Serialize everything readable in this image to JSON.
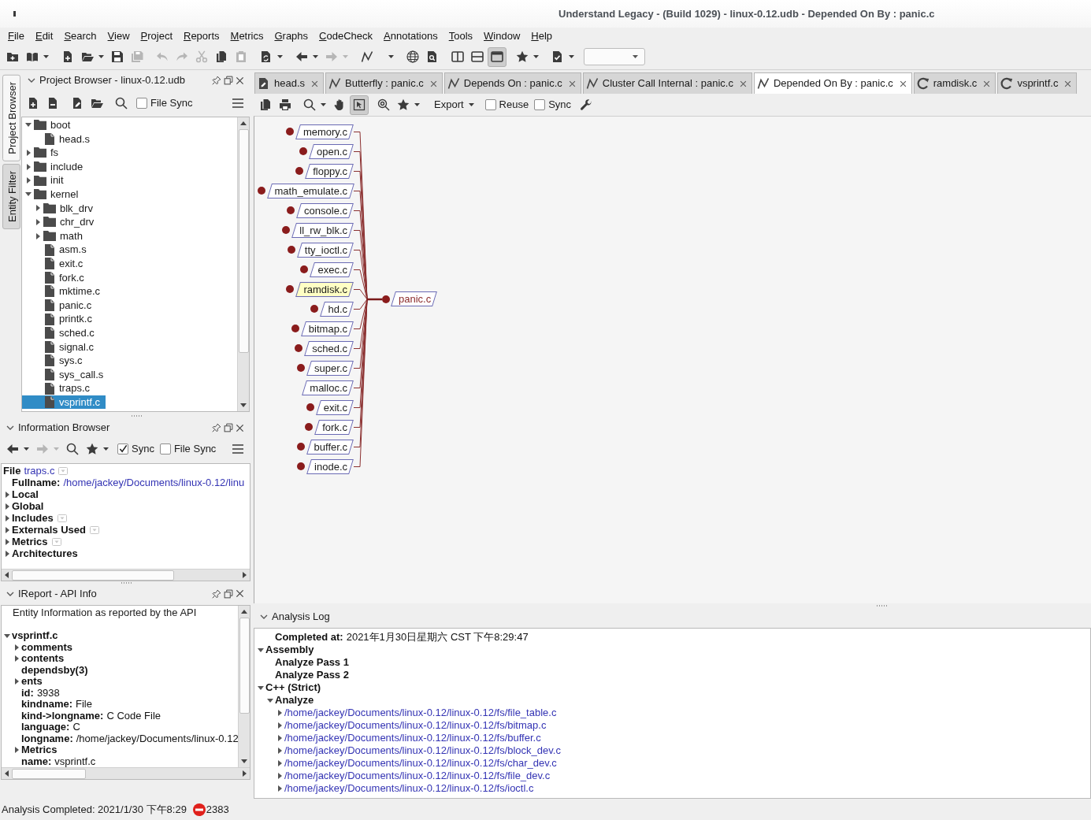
{
  "window": {
    "title": "Understand Legacy - (Build 1029) - linux-0.12.udb - Depended On By : panic.c"
  },
  "menu": [
    "File",
    "Edit",
    "Search",
    "View",
    "Project",
    "Reports",
    "Metrics",
    "Graphs",
    "CodeCheck",
    "Annotations",
    "Tools",
    "Window",
    "Help"
  ],
  "toolbar": [
    [
      {
        "kind": "addfolder",
        "dropdown": false,
        "disabled": false,
        "pressed": false
      },
      {
        "kind": "book",
        "dropdown": true,
        "disabled": false,
        "pressed": false
      }
    ],
    [
      {
        "kind": "addfile",
        "dropdown": false,
        "disabled": false,
        "pressed": false
      },
      {
        "kind": "folder",
        "dropdown": true,
        "disabled": false,
        "pressed": false
      },
      {
        "kind": "save",
        "dropdown": false,
        "disabled": false,
        "pressed": false
      },
      {
        "kind": "saveall",
        "dropdown": false,
        "disabled": true,
        "pressed": false
      }
    ],
    [
      {
        "kind": "undo",
        "dropdown": false,
        "disabled": true,
        "pressed": false
      },
      {
        "kind": "redo",
        "dropdown": false,
        "disabled": true,
        "pressed": false
      },
      {
        "kind": "cut",
        "dropdown": false,
        "disabled": true,
        "pressed": false
      },
      {
        "kind": "copy",
        "dropdown": false,
        "disabled": false,
        "pressed": false
      },
      {
        "kind": "paste",
        "dropdown": false,
        "disabled": true,
        "pressed": false
      }
    ],
    [
      {
        "kind": "sync",
        "dropdown": true,
        "disabled": false,
        "pressed": false
      }
    ],
    [
      {
        "kind": "back",
        "dropdown": true,
        "disabled": false,
        "pressed": false
      },
      {
        "kind": "forward",
        "dropdown": true,
        "disabled": true,
        "pressed": false
      }
    ],
    [
      {
        "kind": "graph",
        "dropdown": true,
        "disabled": false,
        "pressed": false
      }
    ],
    [
      {
        "kind": "globe",
        "dropdown": false,
        "disabled": false,
        "pressed": false
      },
      {
        "kind": "inspect",
        "dropdown": false,
        "disabled": false,
        "pressed": false
      }
    ],
    [
      {
        "kind": "columns",
        "dropdown": false,
        "disabled": false,
        "pressed": false
      },
      {
        "kind": "rows",
        "dropdown": false,
        "disabled": false,
        "pressed": false
      },
      {
        "kind": "window",
        "dropdown": false,
        "disabled": false,
        "pressed": true
      }
    ],
    [
      {
        "kind": "star",
        "dropdown": true,
        "disabled": false,
        "pressed": false
      }
    ],
    [
      {
        "kind": "checklist",
        "dropdown": true,
        "disabled": false,
        "pressed": false
      }
    ],
    [
      {
        "kind": "combo"
      }
    ]
  ],
  "side_tabs": [
    {
      "label": "Project Browser",
      "selected": true
    },
    {
      "label": "Entity Filter",
      "selected": false
    }
  ],
  "project_browser": {
    "title": "Project Browser - linux-0.12.udb",
    "toolbar": [
      [
        {
          "kind": "addfile",
          "dropdown": false,
          "disabled": false,
          "pressed": false
        },
        {
          "kind": "removefile",
          "dropdown": false,
          "disabled": false,
          "pressed": false
        }
      ],
      [
        {
          "kind": "editfile",
          "dropdown": false,
          "disabled": false,
          "pressed": false
        },
        {
          "kind": "folder",
          "dropdown": false,
          "disabled": false,
          "pressed": false
        }
      ],
      [
        {
          "kind": "search",
          "dropdown": false,
          "disabled": false,
          "pressed": false
        }
      ],
      [
        {
          "kind": "checkbox",
          "label": "File Sync",
          "checked": false
        }
      ],
      [
        {
          "kind": "menu",
          "dropdown": false,
          "disabled": false,
          "pressed": false
        }
      ]
    ],
    "tree": [
      {
        "label": "boot",
        "kind": "folder",
        "expanded": true,
        "selected": false,
        "children": [
          {
            "label": "head.s",
            "kind": "file",
            "selected": false
          }
        ]
      },
      {
        "label": "fs",
        "kind": "folder",
        "expanded": false,
        "selected": false
      },
      {
        "label": "include",
        "kind": "folder",
        "expanded": false,
        "selected": false
      },
      {
        "label": "init",
        "kind": "folder",
        "expanded": false,
        "selected": false
      },
      {
        "label": "kernel",
        "kind": "folder",
        "expanded": true,
        "selected": false,
        "children": [
          {
            "label": "blk_drv",
            "kind": "folder",
            "expanded": false,
            "selected": false
          },
          {
            "label": "chr_drv",
            "kind": "folder",
            "expanded": false,
            "selected": false
          },
          {
            "label": "math",
            "kind": "folder",
            "expanded": false,
            "selected": false
          },
          {
            "label": "asm.s",
            "kind": "file",
            "selected": false
          },
          {
            "label": "exit.c",
            "kind": "file",
            "selected": false
          },
          {
            "label": "fork.c",
            "kind": "file",
            "selected": false
          },
          {
            "label": "mktime.c",
            "kind": "file",
            "selected": false
          },
          {
            "label": "panic.c",
            "kind": "file",
            "selected": false
          },
          {
            "label": "printk.c",
            "kind": "file",
            "selected": false
          },
          {
            "label": "sched.c",
            "kind": "file",
            "selected": false
          },
          {
            "label": "signal.c",
            "kind": "file",
            "selected": false
          },
          {
            "label": "sys.c",
            "kind": "file",
            "selected": false
          },
          {
            "label": "sys_call.s",
            "kind": "file",
            "selected": false
          },
          {
            "label": "traps.c",
            "kind": "file",
            "selected": false
          },
          {
            "label": "vsprintf.c",
            "kind": "file",
            "selected": true
          }
        ]
      }
    ]
  },
  "information_browser": {
    "title": "Information Browser",
    "toolbar": [
      [
        {
          "kind": "back",
          "dropdown": true,
          "disabled": false,
          "pressed": false
        },
        {
          "kind": "forward",
          "dropdown": true,
          "disabled": true,
          "pressed": false
        },
        {
          "kind": "search",
          "dropdown": false,
          "disabled": false,
          "pressed": false
        },
        {
          "kind": "star",
          "dropdown": true,
          "disabled": false,
          "pressed": false
        }
      ],
      [
        {
          "kind": "checkbox",
          "label": "Sync",
          "checked": true
        }
      ],
      [
        {
          "kind": "checkbox",
          "label": "File Sync",
          "checked": false
        }
      ],
      [
        {
          "kind": "menu",
          "dropdown": false,
          "disabled": false,
          "pressed": false
        }
      ]
    ],
    "header": {
      "key": "File",
      "link": "traps.c",
      "has_menu": true
    },
    "items": [
      {
        "key": "Fullname:",
        "link": "/home/jackey/Documents/linux-0.12/linu",
        "has_menu": false
      },
      {
        "key": "Local",
        "expanded": false,
        "has_menu": false
      },
      {
        "key": "Global",
        "expanded": false,
        "has_menu": false
      },
      {
        "key": "Includes",
        "expanded": false,
        "has_menu": true
      },
      {
        "key": "Externals Used",
        "expanded": false,
        "has_menu": true
      },
      {
        "key": "Metrics",
        "expanded": false,
        "has_menu": true
      },
      {
        "key": "Architectures",
        "expanded": false,
        "has_menu": false
      }
    ]
  },
  "ireport": {
    "title": "IReport - API Info",
    "intro": "Entity Information as reported by the API",
    "tree": [
      {
        "key": "vsprintf.c",
        "expanded": true,
        "children": [
          {
            "key": "comments",
            "expanded": false
          },
          {
            "key": "contents",
            "expanded": false
          },
          {
            "key": "dependsby(3)"
          },
          {
            "key": "ents",
            "expanded": false
          },
          {
            "key": "id:",
            "value": "3938"
          },
          {
            "key": "kindname:",
            "value": "File"
          },
          {
            "key": "kind->longname:",
            "value": "C Code File"
          },
          {
            "key": "language:",
            "value": "C"
          },
          {
            "key": "longname:",
            "value": "/home/jackey/Documents/linux-0.12"
          },
          {
            "key": "Metrics",
            "expanded": false
          },
          {
            "key": "name:",
            "value": "vsprintf.c"
          }
        ]
      }
    ]
  },
  "tabs": [
    {
      "kind": "asm",
      "label": "head.s",
      "selected": false
    },
    {
      "kind": "graph",
      "label": "Butterfly : panic.c",
      "selected": false
    },
    {
      "kind": "graph",
      "label": "Depends On : panic.c",
      "selected": false
    },
    {
      "kind": "graph",
      "label": "Cluster Call Internal : panic.c",
      "selected": false
    },
    {
      "kind": "graph",
      "label": "Depended On By : panic.c",
      "selected": true
    },
    {
      "kind": "source",
      "label": "ramdisk.c",
      "selected": false
    },
    {
      "kind": "source",
      "label": "vsprintf.c",
      "selected": false
    }
  ],
  "graph_toolbar": [
    [
      {
        "kind": "copy",
        "dropdown": false,
        "disabled": false,
        "pressed": false
      },
      {
        "kind": "print",
        "dropdown": false,
        "disabled": false,
        "pressed": false
      }
    ],
    [
      {
        "kind": "zoom",
        "dropdown": true,
        "disabled": false,
        "pressed": false
      },
      {
        "kind": "hand",
        "dropdown": false,
        "disabled": false,
        "pressed": false
      },
      {
        "kind": "select",
        "dropdown": false,
        "disabled": false,
        "pressed": true
      }
    ],
    [
      {
        "kind": "zoomfit",
        "dropdown": false,
        "disabled": false,
        "pressed": false
      },
      {
        "kind": "star",
        "dropdown": true,
        "disabled": false,
        "pressed": false
      }
    ],
    [
      {
        "kind": "text",
        "label": "Export",
        "dropdown": true,
        "disabled": false,
        "pressed": false
      }
    ],
    [
      {
        "kind": "checkbox",
        "label": "Reuse",
        "checked": false
      }
    ],
    [
      {
        "kind": "checkbox",
        "label": "Sync",
        "checked": false
      }
    ],
    [
      {
        "kind": "wrench",
        "dropdown": false,
        "disabled": false,
        "pressed": false
      }
    ]
  ],
  "graph": {
    "center": {
      "label": "panic.c",
      "expandable": true
    },
    "nodes": [
      {
        "label": "memory.c",
        "expandable": true,
        "selected": false
      },
      {
        "label": "open.c",
        "expandable": true,
        "selected": false
      },
      {
        "label": "floppy.c",
        "expandable": true,
        "selected": false
      },
      {
        "label": "math_emulate.c",
        "expandable": true,
        "selected": false
      },
      {
        "label": "console.c",
        "expandable": true,
        "selected": false
      },
      {
        "label": "ll_rw_blk.c",
        "expandable": true,
        "selected": false
      },
      {
        "label": "tty_ioctl.c",
        "expandable": true,
        "selected": false
      },
      {
        "label": "exec.c",
        "expandable": true,
        "selected": false
      },
      {
        "label": "ramdisk.c",
        "expandable": true,
        "selected": true
      },
      {
        "label": "hd.c",
        "expandable": true,
        "selected": false
      },
      {
        "label": "bitmap.c",
        "expandable": true,
        "selected": false
      },
      {
        "label": "sched.c",
        "expandable": true,
        "selected": false
      },
      {
        "label": "super.c",
        "expandable": true,
        "selected": false
      },
      {
        "label": "malloc.c",
        "expandable": false,
        "selected": false
      },
      {
        "label": "exit.c",
        "expandable": true,
        "selected": false
      },
      {
        "label": "fork.c",
        "expandable": true,
        "selected": false
      },
      {
        "label": "buffer.c",
        "expandable": true,
        "selected": false
      },
      {
        "label": "inode.c",
        "expandable": true,
        "selected": false
      }
    ]
  },
  "analysis_log": {
    "title": "Analysis Log",
    "completed": {
      "key": "Completed at:",
      "value": "2021年1月30日星期六 CST 下午8:29:47"
    },
    "tree": [
      {
        "key": "Assembly",
        "expanded": true,
        "children": [
          {
            "key": "Analyze Pass 1"
          },
          {
            "key": "Analyze Pass 2"
          }
        ]
      },
      {
        "key": "C++ (Strict)",
        "expanded": true,
        "children": [
          {
            "key": "Analyze",
            "expanded": true,
            "children": [
              {
                "link": "/home/jackey/Documents/linux-0.12/linux-0.12/fs/file_table.c",
                "expanded": false
              },
              {
                "link": "/home/jackey/Documents/linux-0.12/linux-0.12/fs/bitmap.c",
                "expanded": false
              },
              {
                "link": "/home/jackey/Documents/linux-0.12/linux-0.12/fs/buffer.c",
                "expanded": false
              },
              {
                "link": "/home/jackey/Documents/linux-0.12/linux-0.12/fs/block_dev.c",
                "expanded": false
              },
              {
                "link": "/home/jackey/Documents/linux-0.12/linux-0.12/fs/char_dev.c",
                "expanded": false
              },
              {
                "link": "/home/jackey/Documents/linux-0.12/linux-0.12/fs/file_dev.c",
                "expanded": false
              },
              {
                "link": "/home/jackey/Documents/linux-0.12/linux-0.12/fs/ioctl.c",
                "expanded": false
              }
            ]
          }
        ]
      }
    ]
  },
  "status_bar": {
    "message": "Analysis Completed: 2021/1/30 下午8:29",
    "error_count": "2383"
  }
}
